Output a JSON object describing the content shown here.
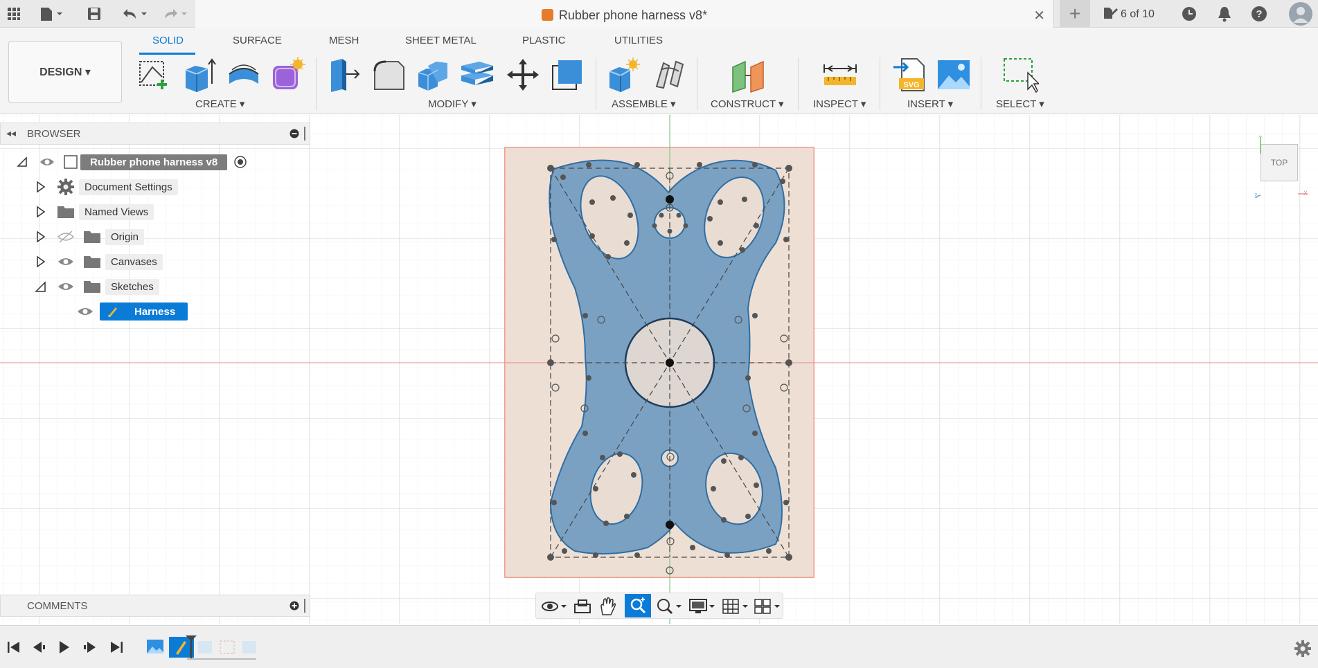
{
  "app": {
    "document_title": "Rubber phone harness v8*",
    "jobs_status": "6 of 10"
  },
  "toolbar": {
    "workspace": "DESIGN ▾",
    "tabs": [
      "SOLID",
      "SURFACE",
      "MESH",
      "SHEET METAL",
      "PLASTIC",
      "UTILITIES"
    ],
    "active_tab": "SOLID",
    "groups": [
      "CREATE ▾",
      "MODIFY ▾",
      "ASSEMBLE ▾",
      "CONSTRUCT ▾",
      "INSPECT ▾",
      "INSERT ▾",
      "SELECT ▾"
    ]
  },
  "browser": {
    "title": "BROWSER",
    "root": "Rubber phone harness v8",
    "items": [
      {
        "label": "Document Settings",
        "icon": "gear-icon"
      },
      {
        "label": "Named Views",
        "icon": "folder-icon"
      },
      {
        "label": "Origin",
        "icon": "folder-icon",
        "hidden": true
      },
      {
        "label": "Canvases",
        "icon": "folder-icon"
      },
      {
        "label": "Sketches",
        "icon": "folder-icon",
        "expanded": true
      },
      {
        "label": "Harness",
        "icon": "sketch-icon",
        "selected": true
      }
    ]
  },
  "comments": {
    "title": "COMMENTS"
  },
  "viewcube": {
    "face": "TOP"
  },
  "colors": {
    "accent": "#0a7bd6",
    "sketch": "#4a84b8",
    "canvas_border": "#f07a6e",
    "axis_red": "#e38c8c",
    "axis_green": "#6cc26c"
  }
}
